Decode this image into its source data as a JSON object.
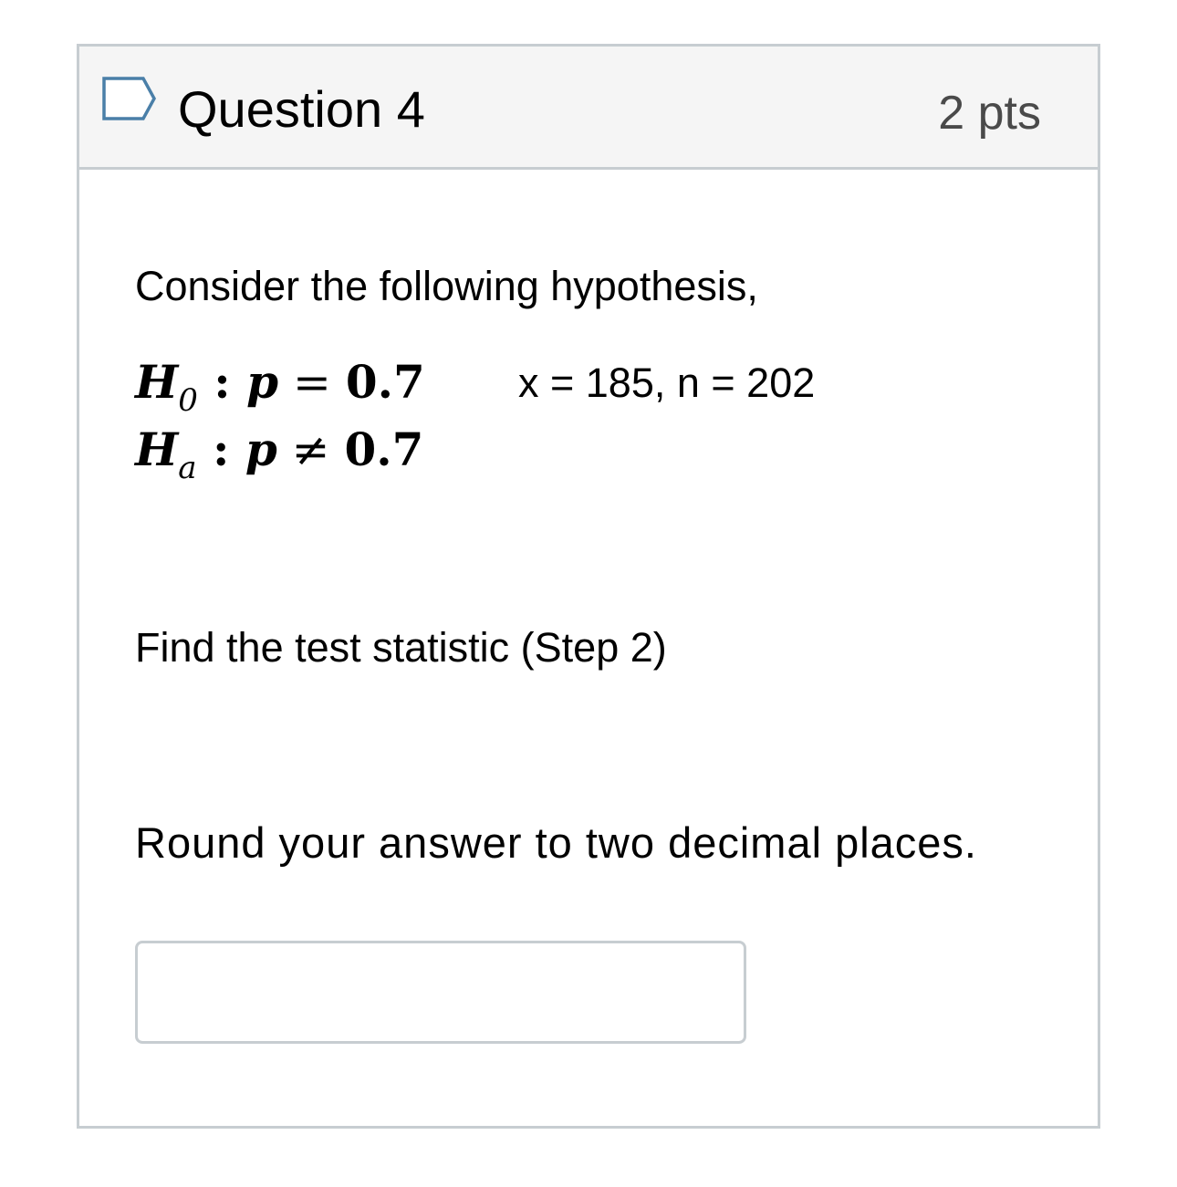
{
  "question": {
    "title": "Question 4",
    "points": "2 pts",
    "flag_icon": "bookmark-flag-icon"
  },
  "body": {
    "intro": "Consider the following hypothesis,",
    "null_hypothesis": {
      "symbol": "H",
      "subscript": "0",
      "colon": " : ",
      "variable": "p",
      "relation": " = ",
      "value": "0.7"
    },
    "alt_hypothesis": {
      "symbol": "H",
      "subscript": "a",
      "colon": " : ",
      "variable": "p",
      "relation": " ≠ ",
      "value": "0.7"
    },
    "given_values": "x = 185, n = 202",
    "prompt": "Find the test statistic (Step 2)",
    "rounding_instruction": "Round your answer to two decimal places.",
    "answer_value": ""
  },
  "colors": {
    "header_bg": "#f5f5f5",
    "border": "#c7cdd1",
    "flag_stroke": "#4a7fa8"
  }
}
